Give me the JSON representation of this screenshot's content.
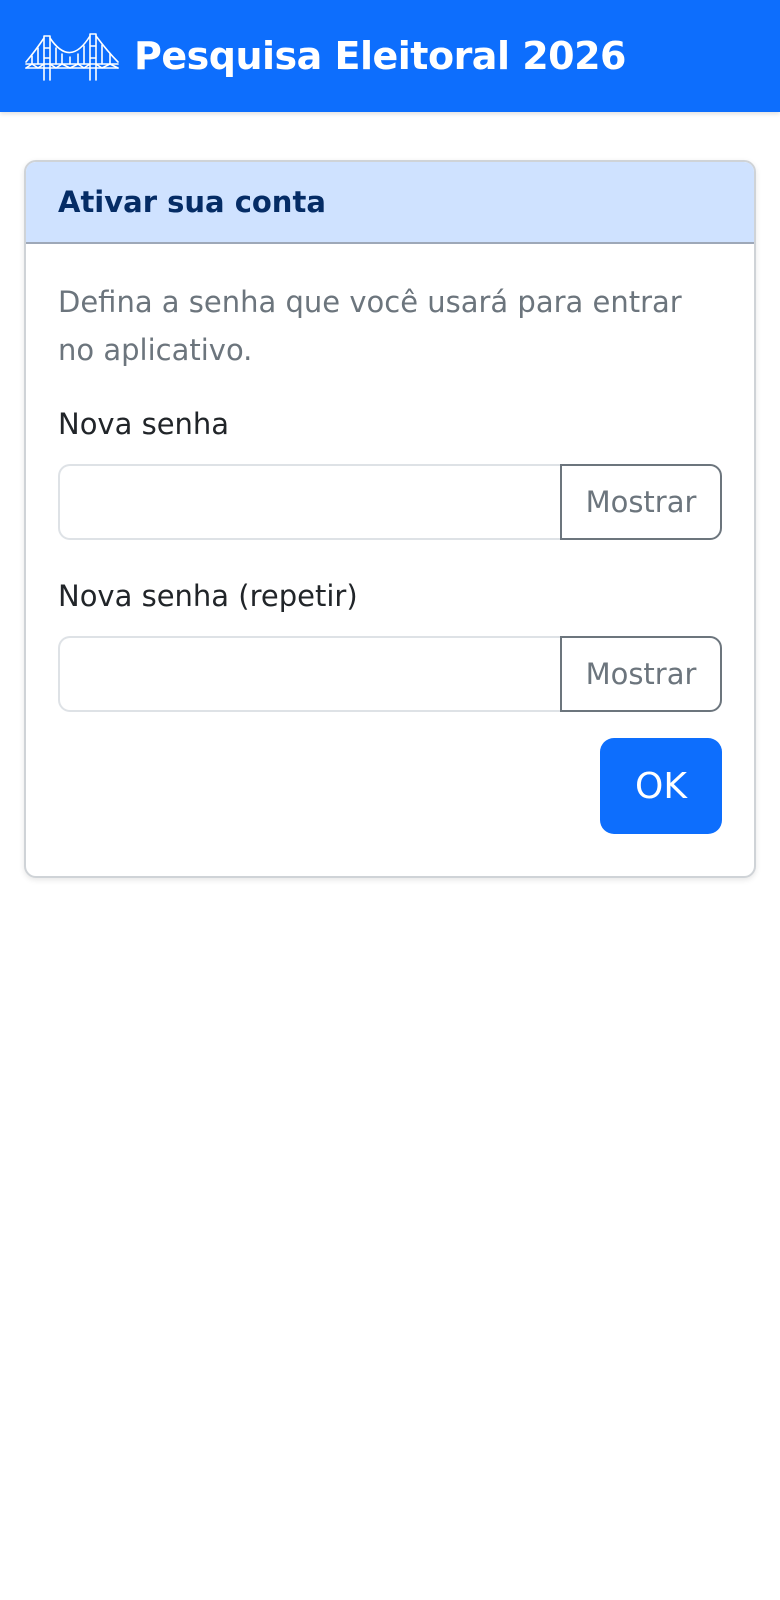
{
  "navbar": {
    "title": "Pesquisa Eleitoral 2026",
    "logo_icon": "bridge-icon",
    "background": "#0d6efd"
  },
  "card": {
    "title": "Ativar sua conta",
    "intro": "Defina a senha que você usará para entrar no aplicativo.",
    "fields": [
      {
        "label": "Nova senha",
        "value": "",
        "toggle_label": "Mostrar"
      },
      {
        "label": "Nova senha (repetir)",
        "value": "",
        "toggle_label": "Mostrar"
      }
    ],
    "submit_label": "OK"
  },
  "colors": {
    "primary": "#0d6efd",
    "header_bg": "#cfe2ff",
    "header_text": "#052c65",
    "muted_text": "#6c757d"
  }
}
